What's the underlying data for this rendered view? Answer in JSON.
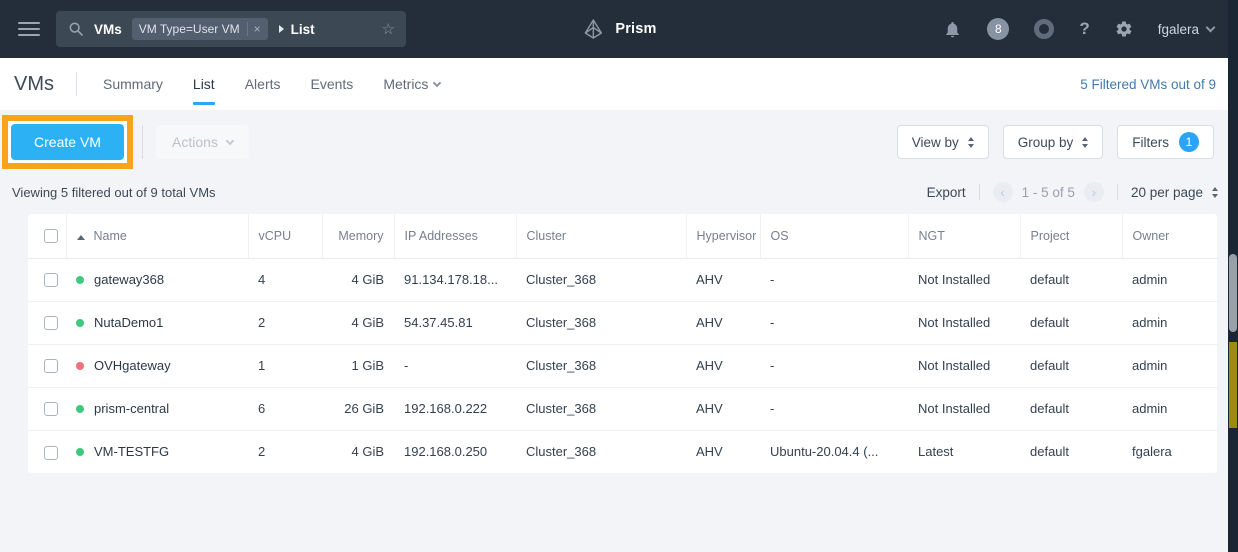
{
  "colors": {
    "accent_blue": "#2cb1f5",
    "highlight_orange": "#f7a41c",
    "status_green": "#3ec97c",
    "status_red": "#f2707a"
  },
  "topbar": {
    "search": {
      "entity": "VMs",
      "filter_tag": "VM Type=User VM",
      "tag_close": "×",
      "breadcrumb": "List"
    },
    "brand": "Prism",
    "notification_badge": "8",
    "help_label": "?",
    "username": "fgalera"
  },
  "nav": {
    "title": "VMs",
    "tabs": [
      {
        "label": "Summary",
        "active": false
      },
      {
        "label": "List",
        "active": true
      },
      {
        "label": "Alerts",
        "active": false
      },
      {
        "label": "Events",
        "active": false
      },
      {
        "label": "Metrics",
        "active": false,
        "has_dropdown": true
      }
    ],
    "filtered_summary": "5 Filtered VMs out of 9"
  },
  "toolbar": {
    "create_vm": "Create VM",
    "actions": "Actions",
    "view_by": "View by",
    "group_by": "Group by",
    "filters": "Filters",
    "filters_count": "1"
  },
  "status_row": {
    "viewing": "Viewing 5 filtered out of 9 total VMs",
    "export": "Export",
    "prev": "‹",
    "range": "1 - 5 of 5",
    "next": "›",
    "page_size": "20 per page"
  },
  "table": {
    "columns": [
      "Name",
      "vCPU",
      "Memory",
      "IP Addresses",
      "Cluster",
      "Hypervisor",
      "OS",
      "NGT",
      "Project",
      "Owner"
    ],
    "rows": [
      {
        "status_color": "#3ec97c",
        "name": "gateway368",
        "vcpu": "4",
        "memory": "4 GiB",
        "ip": "91.134.178.18...",
        "cluster": "Cluster_368",
        "hypervisor": "AHV",
        "os": "-",
        "ngt": "Not Installed",
        "project": "default",
        "owner": "admin"
      },
      {
        "status_color": "#3ec97c",
        "name": "NutaDemo1",
        "vcpu": "2",
        "memory": "4 GiB",
        "ip": "54.37.45.81",
        "cluster": "Cluster_368",
        "hypervisor": "AHV",
        "os": "-",
        "ngt": "Not Installed",
        "project": "default",
        "owner": "admin"
      },
      {
        "status_color": "#f2707a",
        "name": "OVHgateway",
        "vcpu": "1",
        "memory": "1 GiB",
        "ip": "-",
        "cluster": "Cluster_368",
        "hypervisor": "AHV",
        "os": "-",
        "ngt": "Not Installed",
        "project": "default",
        "owner": "admin"
      },
      {
        "status_color": "#3ec97c",
        "name": "prism-central",
        "vcpu": "6",
        "memory": "26 GiB",
        "ip": "192.168.0.222",
        "cluster": "Cluster_368",
        "hypervisor": "AHV",
        "os": "-",
        "ngt": "Not Installed",
        "project": "default",
        "owner": "admin"
      },
      {
        "status_color": "#3ec97c",
        "name": "VM-TESTFG",
        "vcpu": "2",
        "memory": "4 GiB",
        "ip": "192.168.0.250",
        "cluster": "Cluster_368",
        "hypervisor": "AHV",
        "os": "Ubuntu-20.04.4 (...",
        "ngt": "Latest",
        "project": "default",
        "owner": "fgalera"
      }
    ]
  }
}
